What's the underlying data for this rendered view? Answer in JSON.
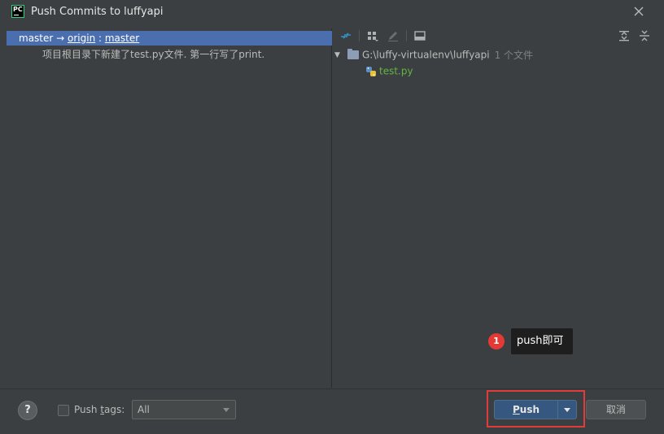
{
  "window": {
    "title": "Push Commits to luffyapi",
    "app_icon_text": "PC"
  },
  "left": {
    "branch": {
      "local": "master",
      "arrow": " → ",
      "remote": "origin",
      "sep": " : ",
      "target": "master"
    },
    "commit_message": "项目根目录下新建了test.py文件. 第一行写了print."
  },
  "right": {
    "root_path": "G:\\luffy-virtualenv\\luffyapi",
    "root_count": "1 个文件",
    "file_name": "test.py"
  },
  "bottom": {
    "help_label": "?",
    "push_tags_prefix": "Push ",
    "push_tags_mnemonic": "t",
    "push_tags_suffix": "ags:",
    "tags_value": "All",
    "push_mnemonic": "P",
    "push_rest": "ush",
    "cancel_label": "取消"
  },
  "annotation": {
    "badge": "1",
    "text": "push即可"
  },
  "colors": {
    "selection": "#4b6eaf",
    "push_button": "#365880",
    "highlight": "#e03c3c",
    "file_added": "#62b543"
  }
}
